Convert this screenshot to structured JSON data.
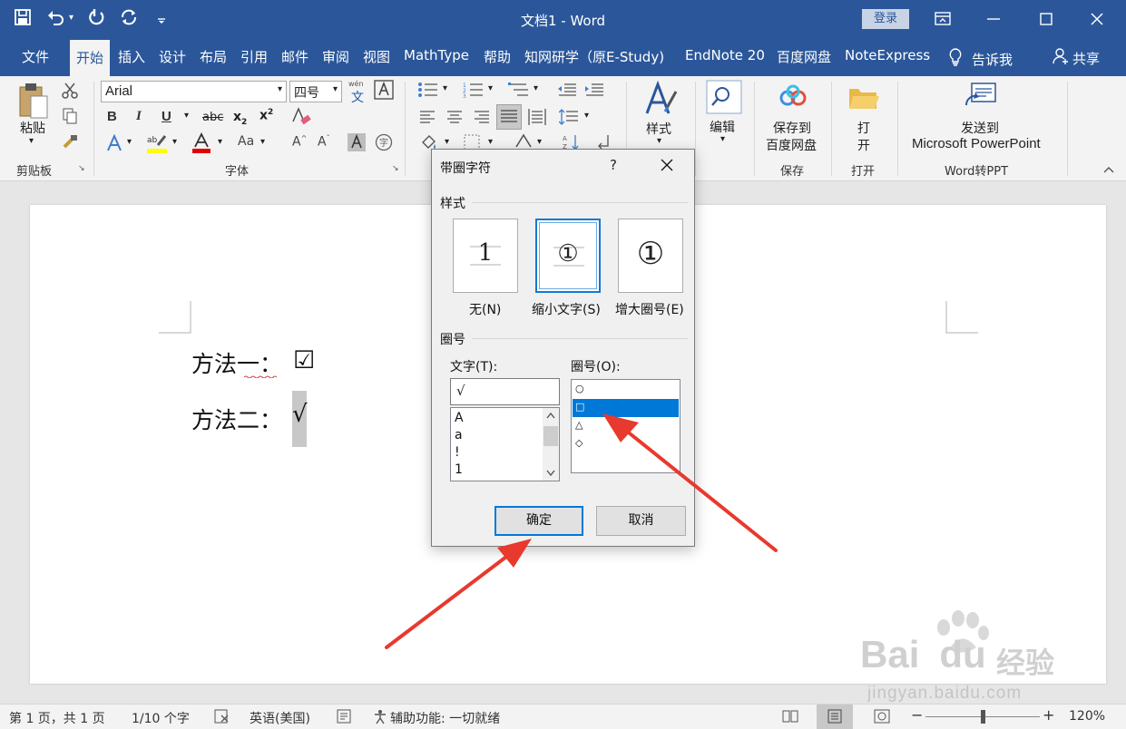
{
  "app": {
    "title": "文档1  -  Word",
    "login_label": "登录",
    "accent_color": "#2b579a"
  },
  "tabs": [
    {
      "label": "文件"
    },
    {
      "label": "开始",
      "active": true
    },
    {
      "label": "插入"
    },
    {
      "label": "设计"
    },
    {
      "label": "布局"
    },
    {
      "label": "引用"
    },
    {
      "label": "邮件"
    },
    {
      "label": "审阅"
    },
    {
      "label": "视图"
    },
    {
      "label": "MathType"
    },
    {
      "label": "帮助"
    },
    {
      "label": "知网研学（原E-Study)"
    },
    {
      "label": "EndNote 20"
    },
    {
      "label": "百度网盘"
    },
    {
      "label": "NoteExpress"
    }
  ],
  "tell_me": "告诉我",
  "share": "共享",
  "ribbon": {
    "paste_label": "粘贴",
    "clipboard_label": "剪贴板",
    "font_name": "Arial",
    "font_size": "四号",
    "font_group_label": "字体",
    "styles_label": "样式",
    "edit_label": "编辑",
    "baidu_save_line1": "保存到",
    "baidu_save_line2": "百度网盘",
    "save_group_label": "保存",
    "open_line1": "打",
    "open_line2": "开",
    "open_group_label": "打开",
    "ppt_line1": "发送到",
    "ppt_line2": "Microsoft PowerPoint",
    "ppt_group_label": "Word转PPT",
    "wen_label": "wén",
    "wen_char": "文"
  },
  "document": {
    "line1_label": "方法一：",
    "line1_symbol": "☑",
    "line2_label": "方法二：",
    "line2_symbol": "√"
  },
  "dialog": {
    "title": "带圈字符",
    "help": "?",
    "style_section": "样式",
    "styles": [
      {
        "glyph": "1",
        "caption": "无(N)"
      },
      {
        "glyph": "①",
        "caption": "缩小文字(S)",
        "selected": true
      },
      {
        "glyph": "①",
        "caption": "增大圈号(E)"
      }
    ],
    "enclosure_section": "圈号",
    "text_label": "文字(T):",
    "text_value": "√",
    "text_list": [
      "A",
      "a",
      "!",
      "1"
    ],
    "enclosure_label": "圈号(O):",
    "enclosure_list": [
      "○",
      "□",
      "△",
      "◇"
    ],
    "enclosure_selected_index": 1,
    "ok_label": "确定",
    "cancel_label": "取消"
  },
  "statusbar": {
    "page": "第 1 页，共 1 页",
    "words": "1/10 个字",
    "language": "英语(美国)",
    "accessibility": "辅助功能: 一切就绪",
    "zoom": "120%",
    "zoom_minus": "−",
    "zoom_plus": "+"
  },
  "watermark": {
    "brand": "Bai",
    "brand2": "du",
    "brand_cn": "经验",
    "url": "jingyan.baidu.com"
  }
}
